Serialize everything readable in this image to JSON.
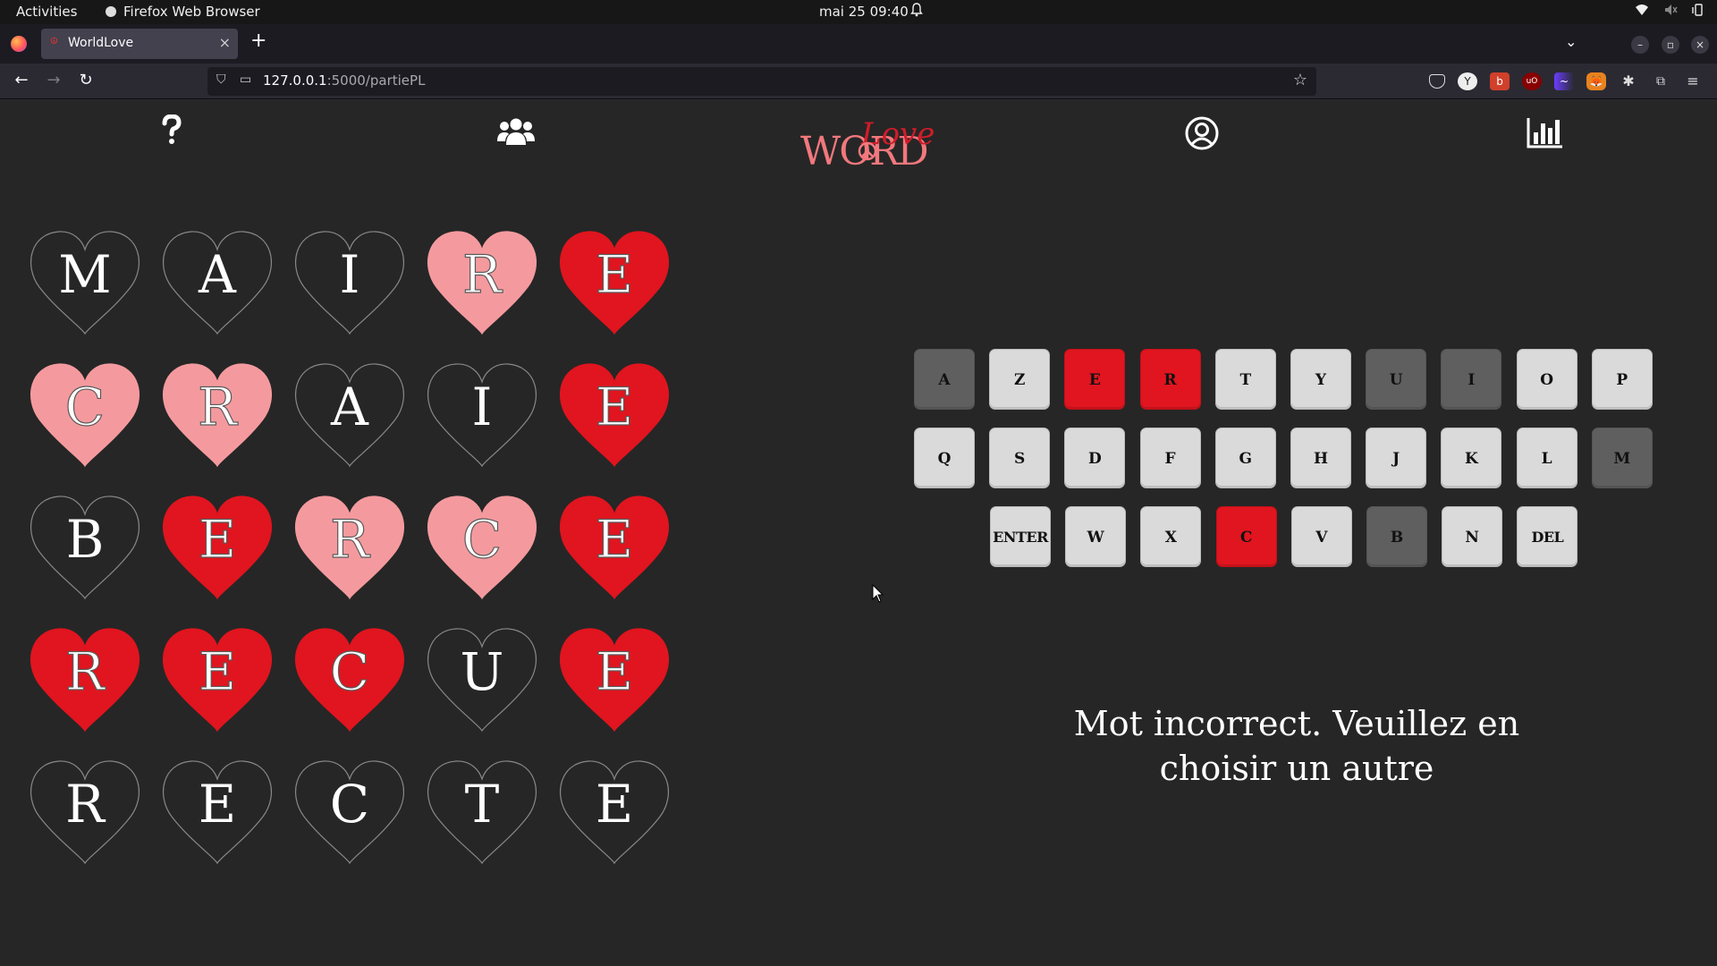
{
  "system_bar": {
    "activities": "Activities",
    "app_name": "Firefox Web Browser",
    "clock": "mai 25  09:40"
  },
  "browser": {
    "tab_title": "WorldLove",
    "url_host": "127.0.0.1",
    "url_path": ":5000/partiePL"
  },
  "header": {
    "help_icon": "question-mark-icon",
    "friends_icon": "users-icon",
    "logo_word": "WORD",
    "logo_love": "Love",
    "profile_icon": "user-circle-icon",
    "stats_icon": "bar-chart-icon"
  },
  "colors": {
    "red": "#e0151f",
    "pink": "#f49a9e",
    "absent": "#5f5f5f",
    "key": "#dadada",
    "background": "#262626"
  },
  "grid": [
    [
      {
        "l": "M",
        "s": "empty"
      },
      {
        "l": "A",
        "s": "empty"
      },
      {
        "l": "I",
        "s": "empty"
      },
      {
        "l": "R",
        "s": "pink"
      },
      {
        "l": "E",
        "s": "red"
      }
    ],
    [
      {
        "l": "C",
        "s": "pink"
      },
      {
        "l": "R",
        "s": "pink"
      },
      {
        "l": "A",
        "s": "empty"
      },
      {
        "l": "I",
        "s": "empty"
      },
      {
        "l": "E",
        "s": "red"
      }
    ],
    [
      {
        "l": "B",
        "s": "empty"
      },
      {
        "l": "E",
        "s": "red"
      },
      {
        "l": "R",
        "s": "pink"
      },
      {
        "l": "C",
        "s": "pink"
      },
      {
        "l": "E",
        "s": "red"
      }
    ],
    [
      {
        "l": "R",
        "s": "red"
      },
      {
        "l": "E",
        "s": "red"
      },
      {
        "l": "C",
        "s": "red"
      },
      {
        "l": "U",
        "s": "empty"
      },
      {
        "l": "E",
        "s": "red"
      }
    ],
    [
      {
        "l": "R",
        "s": "empty"
      },
      {
        "l": "E",
        "s": "empty"
      },
      {
        "l": "C",
        "s": "empty"
      },
      {
        "l": "T",
        "s": "empty"
      },
      {
        "l": "E",
        "s": "empty"
      }
    ]
  ],
  "keyboard": [
    [
      {
        "k": "A",
        "s": "absent"
      },
      {
        "k": "Z",
        "s": "normal"
      },
      {
        "k": "E",
        "s": "red"
      },
      {
        "k": "R",
        "s": "red"
      },
      {
        "k": "T",
        "s": "normal"
      },
      {
        "k": "Y",
        "s": "normal"
      },
      {
        "k": "U",
        "s": "absent"
      },
      {
        "k": "I",
        "s": "absent"
      },
      {
        "k": "O",
        "s": "normal"
      },
      {
        "k": "P",
        "s": "normal"
      }
    ],
    [
      {
        "k": "Q",
        "s": "normal"
      },
      {
        "k": "S",
        "s": "normal"
      },
      {
        "k": "D",
        "s": "normal"
      },
      {
        "k": "F",
        "s": "normal"
      },
      {
        "k": "G",
        "s": "normal"
      },
      {
        "k": "H",
        "s": "normal"
      },
      {
        "k": "J",
        "s": "normal"
      },
      {
        "k": "K",
        "s": "normal"
      },
      {
        "k": "L",
        "s": "normal"
      },
      {
        "k": "M",
        "s": "absent"
      }
    ],
    [
      {
        "k": "ENTER",
        "s": "normal"
      },
      {
        "k": "W",
        "s": "normal"
      },
      {
        "k": "X",
        "s": "normal"
      },
      {
        "k": "C",
        "s": "red"
      },
      {
        "k": "V",
        "s": "normal"
      },
      {
        "k": "B",
        "s": "absent"
      },
      {
        "k": "N",
        "s": "normal"
      },
      {
        "k": "DEL",
        "s": "normal"
      }
    ]
  ],
  "message": {
    "line1": "Mot incorrect. Veuillez en",
    "line2": "choisir un autre"
  }
}
